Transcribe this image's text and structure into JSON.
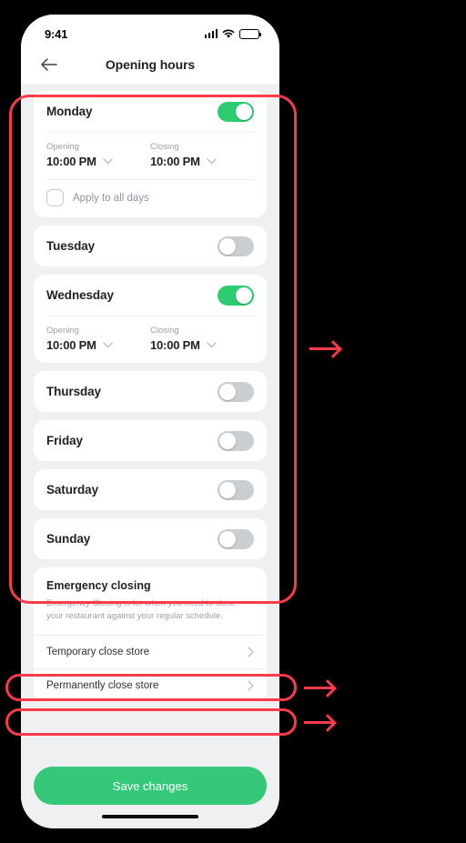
{
  "status_bar": {
    "time": "9:41",
    "signal_icon": "signal-bars-icon",
    "wifi_icon": "wifi-icon",
    "battery_icon": "battery-icon"
  },
  "header": {
    "back_icon": "back-arrow-icon",
    "title": "Opening hours"
  },
  "labels": {
    "opening": "Opening",
    "closing": "Closing",
    "apply_all": "Apply to all days",
    "chevron_down_icon": "chevron-down-icon",
    "chevron_right_icon": "chevron-right-icon"
  },
  "days": [
    {
      "name": "Monday",
      "enabled": true,
      "opening_time": "10:00 PM",
      "closing_time": "10:00 PM",
      "has_apply_all": true,
      "apply_all_checked": false
    },
    {
      "name": "Tuesday",
      "enabled": false,
      "opening_time": "",
      "closing_time": "",
      "has_apply_all": false,
      "apply_all_checked": false
    },
    {
      "name": "Wednesday",
      "enabled": true,
      "opening_time": "10:00 PM",
      "closing_time": "10:00 PM",
      "has_apply_all": false,
      "apply_all_checked": false
    },
    {
      "name": "Thursday",
      "enabled": false,
      "opening_time": "",
      "closing_time": "",
      "has_apply_all": false,
      "apply_all_checked": false
    },
    {
      "name": "Friday",
      "enabled": false,
      "opening_time": "",
      "closing_time": "",
      "has_apply_all": false,
      "apply_all_checked": false
    },
    {
      "name": "Saturday",
      "enabled": false,
      "opening_time": "",
      "closing_time": "",
      "has_apply_all": false,
      "apply_all_checked": false
    },
    {
      "name": "Sunday",
      "enabled": false,
      "opening_time": "",
      "closing_time": "",
      "has_apply_all": false,
      "apply_all_checked": false
    }
  ],
  "emergency": {
    "title": "Emergency closing",
    "description": "Emergency Closing is for when you need to close your restaurant against your regular schedule.",
    "links": [
      {
        "label": "Temporary close store"
      },
      {
        "label": "Permanently close store"
      }
    ]
  },
  "footer": {
    "save_label": "Save changes"
  },
  "colors": {
    "accent_green": "#2ecc71",
    "save_green": "#35c878",
    "toggle_off": "#c9ced3",
    "annotation_red": "#fb3b4a",
    "page_bg": "#eef0f2",
    "card_bg": "#ffffff",
    "text_primary": "#1d2125",
    "text_muted": "#98a0a8"
  }
}
